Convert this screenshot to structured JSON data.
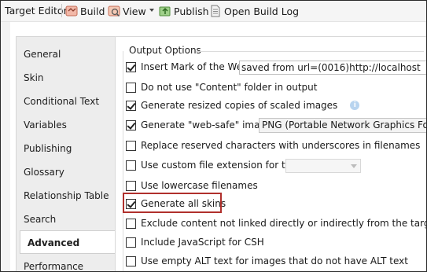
{
  "toolbar": {
    "title": "Target Editor",
    "build_label": "Build",
    "view_label": "View",
    "publish_label": "Publish",
    "open_log_label": "Open Build Log"
  },
  "sidebar": {
    "items": [
      {
        "label": "General"
      },
      {
        "label": "Skin"
      },
      {
        "label": "Conditional Text"
      },
      {
        "label": "Variables"
      },
      {
        "label": "Publishing"
      },
      {
        "label": "Glossary"
      },
      {
        "label": "Relationship Table"
      },
      {
        "label": "Search"
      },
      {
        "label": "Advanced",
        "selected": true
      },
      {
        "label": "Performance"
      }
    ]
  },
  "output_options": {
    "title": "Output Options",
    "options": [
      {
        "label": "Insert Mark of the Web",
        "checked": true
      },
      {
        "label": "Do not use \"Content\" folder in output",
        "checked": false
      },
      {
        "label": "Generate resized copies of scaled images",
        "checked": true
      },
      {
        "label": "Generate \"web-safe\" images",
        "checked": true
      },
      {
        "label": "Replace reserved characters with underscores in filenames",
        "checked": false
      },
      {
        "label": "Use custom file extension for topics",
        "checked": false
      },
      {
        "label": "Use lowercase filenames",
        "checked": false
      },
      {
        "label": "Generate all skins",
        "checked": true
      },
      {
        "label": "Exclude content not linked directly or indirectly from the target",
        "checked": false
      },
      {
        "label": "Include JavaScript for CSH",
        "checked": false
      },
      {
        "label": "Use empty ALT text for images that do not have ALT text",
        "checked": false
      }
    ],
    "mark_of_web_value": "saved from url=(0016)http://localhost",
    "websafe_format": "PNG (Portable Network Graphics Format)"
  },
  "colors": {
    "highlight_border": "#b0302c",
    "selected_tab_bg": "#ffffff",
    "sidebar_bg": "#ededed"
  }
}
